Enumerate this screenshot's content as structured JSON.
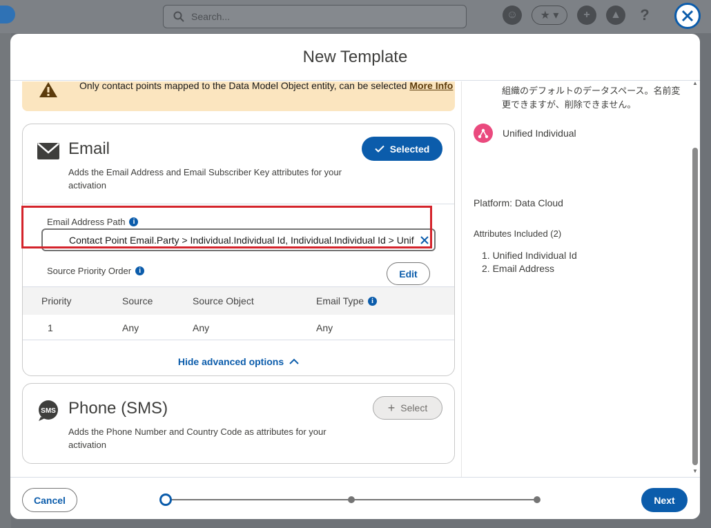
{
  "app": {
    "search_placeholder": "Search..."
  },
  "modal": {
    "title": "New Template"
  },
  "warning": {
    "text": "Only contact points mapped to the Data Model Object entity, can be selected",
    "link": "More Info"
  },
  "email_card": {
    "title": "Email",
    "description": "Adds the Email Address and Email Subscriber Key attributes for your activation",
    "selected_label": "Selected",
    "path_label": "Email Address Path",
    "path_value": "Contact Point Email.Party > Individual.Individual Id, Individual.Individual Id > Unified Link Individual.Source Record Id",
    "spo_label": "Source Priority Order",
    "edit_label": "Edit",
    "table": {
      "columns": [
        "Priority",
        "Source",
        "Source Object",
        "Email Type"
      ],
      "rows": [
        [
          "1",
          "Any",
          "Any",
          "Any"
        ]
      ]
    },
    "hide_advanced": "Hide advanced options"
  },
  "phone_card": {
    "title": "Phone (SMS)",
    "description": "Adds the Phone Number and Country Code as attributes for your activation",
    "select_label": "Select"
  },
  "side_panel": {
    "jp_text": "組織のデフォルトのデータスペース。名前変更できますが、削除できません。",
    "entity": "Unified Individual",
    "platform": "Platform: Data Cloud",
    "attributes_heading": "Attributes Included (2)",
    "attributes": [
      "1. Unified Individual Id",
      "2. Email Address"
    ]
  },
  "footer": {
    "cancel_label": "Cancel",
    "next_label": "Next",
    "progress": {
      "current_step": 1,
      "total_steps": 3
    }
  },
  "colors": {
    "brand": "#0b5cab",
    "warning_bg": "#fbe5bf",
    "highlight": "#d4232b",
    "entity_icon": "#ea4a7e"
  }
}
